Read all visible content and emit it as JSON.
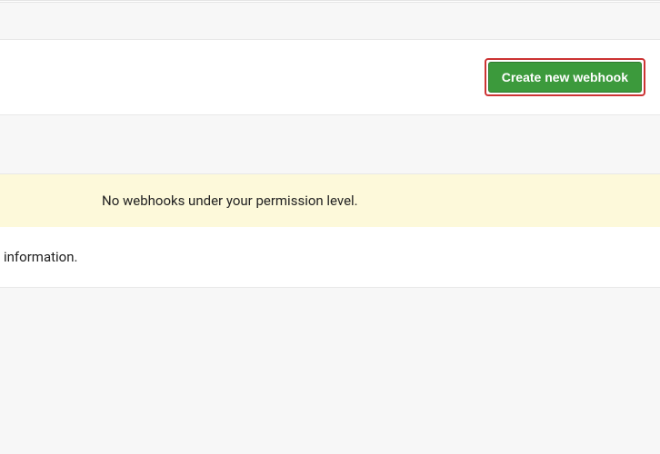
{
  "header": {
    "create_button_label": "Create new webhook"
  },
  "notice": {
    "message": "No webhooks under your permission level."
  },
  "info": {
    "text": "information."
  }
}
